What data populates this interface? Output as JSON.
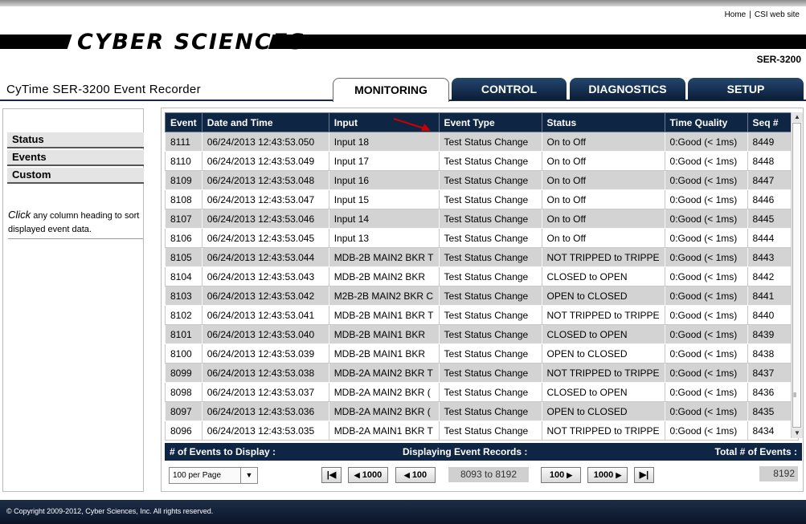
{
  "header": {
    "links": [
      "Home",
      "CSI web site"
    ],
    "logo_text": "CYBER SCIENCES",
    "trademark": "™",
    "model": "SER-3200",
    "app_title": "CyTime SER-3200 Event Recorder"
  },
  "tabs": [
    {
      "label": "MONITORING",
      "active": true
    },
    {
      "label": "CONTROL",
      "active": false
    },
    {
      "label": "DIAGNOSTICS",
      "active": false
    },
    {
      "label": "SETUP",
      "active": false
    }
  ],
  "sidebar": {
    "items": [
      "Status",
      "Events",
      "Custom"
    ],
    "note_em": "Click",
    "note_text": " any column heading to sort displayed event data."
  },
  "table": {
    "columns": [
      "Event",
      "Date and Time",
      "Input",
      "Event Type",
      "Status",
      "Time Quality",
      "Seq #"
    ],
    "rows": [
      [
        "8111",
        "06/24/2013  12:43:53.050",
        "Input 18",
        "Test Status Change",
        "On to Off",
        "0:Good (< 1ms)",
        "8449"
      ],
      [
        "8110",
        "06/24/2013  12:43:53.049",
        "Input 17",
        "Test Status Change",
        "On to Off",
        "0:Good (< 1ms)",
        "8448"
      ],
      [
        "8109",
        "06/24/2013  12:43:53.048",
        "Input 16",
        "Test Status Change",
        "On to Off",
        "0:Good (< 1ms)",
        "8447"
      ],
      [
        "8108",
        "06/24/2013  12:43:53.047",
        "Input 15",
        "Test Status Change",
        "On to Off",
        "0:Good (< 1ms)",
        "8446"
      ],
      [
        "8107",
        "06/24/2013  12:43:53.046",
        "Input 14",
        "Test Status Change",
        "On to Off",
        "0:Good (< 1ms)",
        "8445"
      ],
      [
        "8106",
        "06/24/2013  12:43:53.045",
        "Input 13",
        "Test Status Change",
        "On to Off",
        "0:Good (< 1ms)",
        "8444"
      ],
      [
        "8105",
        "06/24/2013  12:43:53.044",
        "MDB-2B MAIN2 BKR T",
        "Test Status Change",
        "NOT TRIPPED to TRIPPE",
        "0:Good (< 1ms)",
        "8443"
      ],
      [
        "8104",
        "06/24/2013  12:43:53.043",
        "MDB-2B MAIN2 BKR",
        "Test Status Change",
        "CLOSED to OPEN",
        "0:Good (< 1ms)",
        "8442"
      ],
      [
        "8103",
        "06/24/2013  12:43:53.042",
        "M2B-2B MAIN2 BKR C",
        "Test Status Change",
        "OPEN to CLOSED",
        "0:Good (< 1ms)",
        "8441"
      ],
      [
        "8102",
        "06/24/2013  12:43:53.041",
        "MDB-2B MAIN1 BKR T",
        "Test Status Change",
        "NOT TRIPPED to TRIPPE",
        "0:Good (< 1ms)",
        "8440"
      ],
      [
        "8101",
        "06/24/2013  12:43:53.040",
        "MDB-2B MAIN1 BKR",
        "Test Status Change",
        "CLOSED to OPEN",
        "0:Good (< 1ms)",
        "8439"
      ],
      [
        "8100",
        "06/24/2013  12:43:53.039",
        "MDB-2B MAIN1 BKR",
        "Test Status Change",
        "OPEN to CLOSED",
        "0:Good (< 1ms)",
        "8438"
      ],
      [
        "8099",
        "06/24/2013  12:43:53.038",
        "MDB-2A MAIN2 BKR T",
        "Test Status Change",
        "NOT TRIPPED to TRIPPE",
        "0:Good (< 1ms)",
        "8437"
      ],
      [
        "8098",
        "06/24/2013  12:43:53.037",
        "MDB-2A MAIN2 BKR (",
        "Test Status Change",
        "CLOSED to OPEN",
        "0:Good (< 1ms)",
        "8436"
      ],
      [
        "8097",
        "06/24/2013  12:43:53.036",
        "MDB-2A MAIN2 BKR (",
        "Test Status Change",
        "OPEN to CLOSED",
        "0:Good (< 1ms)",
        "8435"
      ],
      [
        "8096",
        "06/24/2013  12:43:53.035",
        "MDB-2A MAIN1 BKR T",
        "Test Status Change",
        "NOT TRIPPED to TRIPPE",
        "0:Good (< 1ms)",
        "8434"
      ]
    ]
  },
  "footer": {
    "events_to_display_label": "# of Events to Display :",
    "displaying_label": "Displaying Event Records :",
    "total_label": "Total  # of Events :",
    "per_page_value": "100 per Page",
    "first_icon": "skip-to-first-icon",
    "back_1000": "1000",
    "back_100": "100",
    "range": "8093 to 8192",
    "fwd_100": "100",
    "fwd_1000": "1000",
    "last_icon": "skip-to-last-icon",
    "total": "8192"
  },
  "copyright": "© Copyright 2009-2012, Cyber Sciences, Inc.  All rights reserved.",
  "colors": {
    "header_navy": "#0f2544",
    "tab_blue": "#24466e",
    "row_gray": "#d3d3d3",
    "annotation_red": "#cc0000"
  }
}
